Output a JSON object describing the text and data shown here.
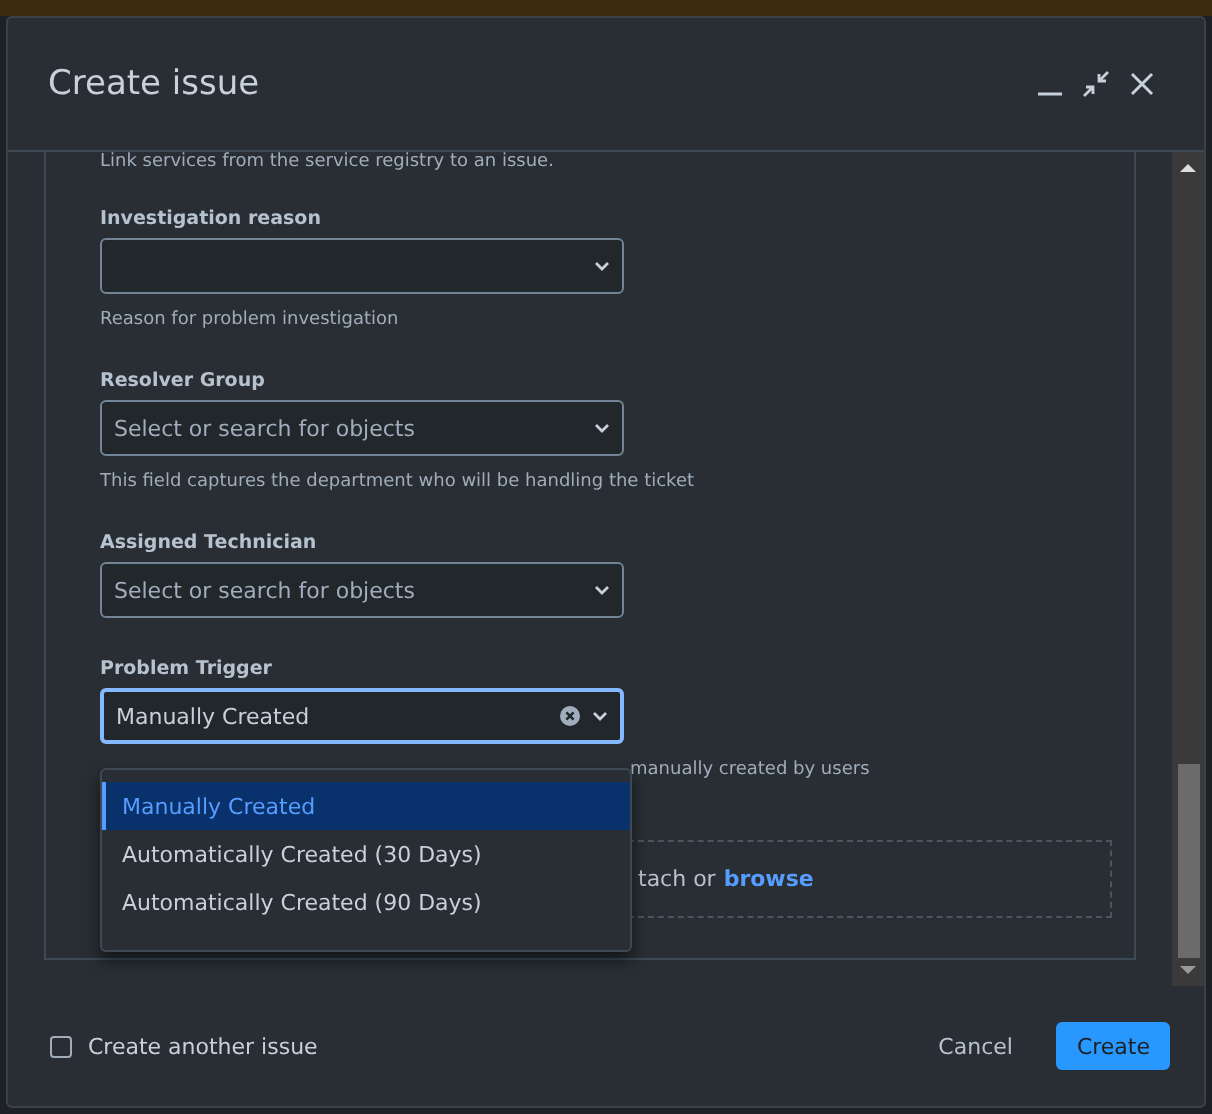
{
  "dialog": {
    "title": "Create issue"
  },
  "intro": "Link services from the service registry to an issue.",
  "fields": [
    {
      "kind": "select",
      "label": "Investigation reason",
      "help": "Reason for problem investigation",
      "focused": false
    },
    {
      "kind": "select",
      "label": "Resolver Group",
      "placeholder": "Select or search for objects",
      "help": "This field captures the department who will be handling the ticket",
      "focused": false
    },
    {
      "kind": "select",
      "label": "Assigned Technician",
      "placeholder": "Select or search for objects",
      "focused": false
    },
    {
      "kind": "select",
      "label": "Problem Trigger",
      "value": "Manually Created",
      "help": "manually created by users",
      "focused": true,
      "clearable": true,
      "expanded": true
    }
  ],
  "dropdown_options": [
    {
      "label": "Manually Created",
      "selected": true
    },
    {
      "label": "Automatically Created (30 Days)",
      "selected": false
    },
    {
      "label": "Automatically Created (90 Days)",
      "selected": false
    }
  ],
  "dropzone": {
    "text": "tach or",
    "link": "browse"
  },
  "footer": {
    "create_another": {
      "label": "Create another issue",
      "checked": false
    },
    "cancel": "Cancel",
    "create": "Create"
  }
}
